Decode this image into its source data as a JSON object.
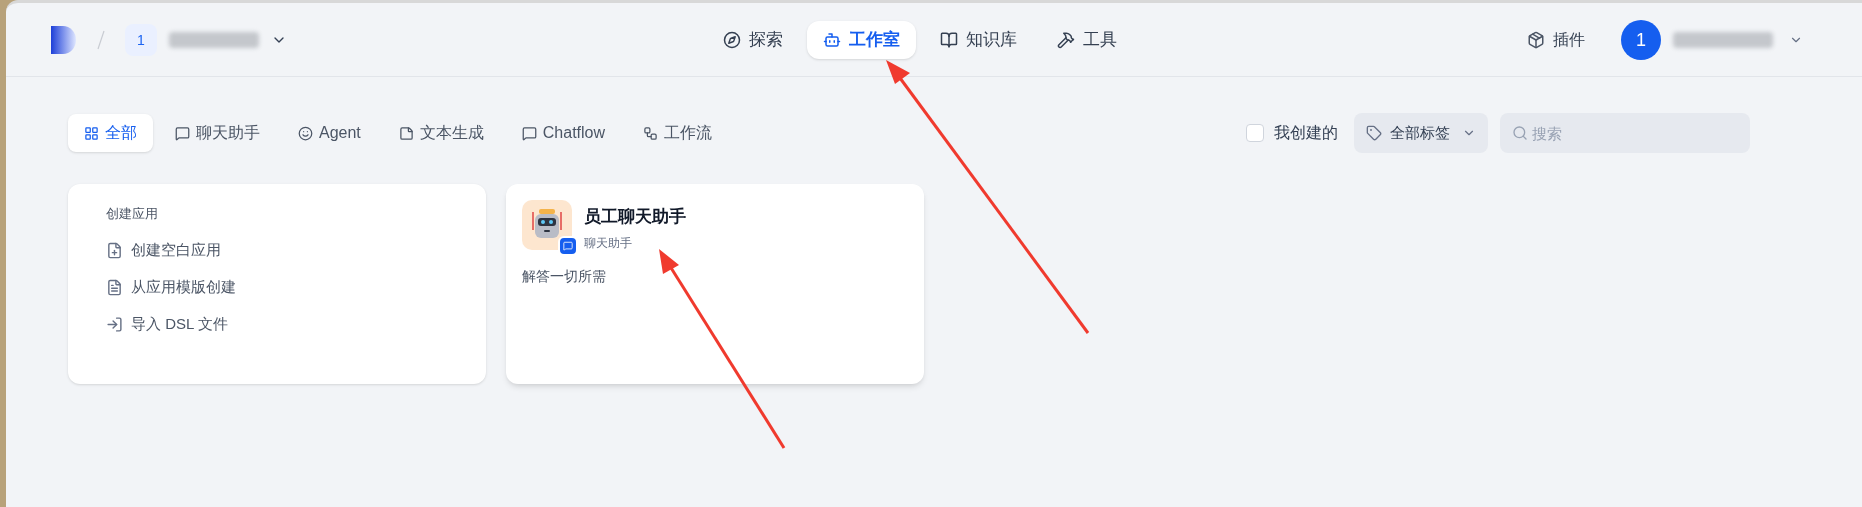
{
  "header": {
    "workspace_badge": "1",
    "nav": [
      {
        "label": "探索",
        "selected": false
      },
      {
        "label": "工作室",
        "selected": true
      },
      {
        "label": "知识库",
        "selected": false
      },
      {
        "label": "工具",
        "selected": false
      }
    ],
    "plugins": "插件",
    "avatar": "1"
  },
  "filters": [
    {
      "label": "全部",
      "selected": true
    },
    {
      "label": "聊天助手",
      "selected": false
    },
    {
      "label": "Agent",
      "selected": false
    },
    {
      "label": "文本生成",
      "selected": false
    },
    {
      "label": "Chatflow",
      "selected": false
    },
    {
      "label": "工作流",
      "selected": false
    }
  ],
  "mine": {
    "label": "我创建的",
    "checked": false
  },
  "tags": "全部标签",
  "search": {
    "placeholder": "搜索"
  },
  "create": {
    "title": "创建应用",
    "actions": [
      "创建空白应用",
      "从应用模版创建",
      "导入 DSL 文件"
    ]
  },
  "apps": [
    {
      "name": "员工聊天助手",
      "type": "聊天助手",
      "description": "解答一切所需"
    }
  ]
}
